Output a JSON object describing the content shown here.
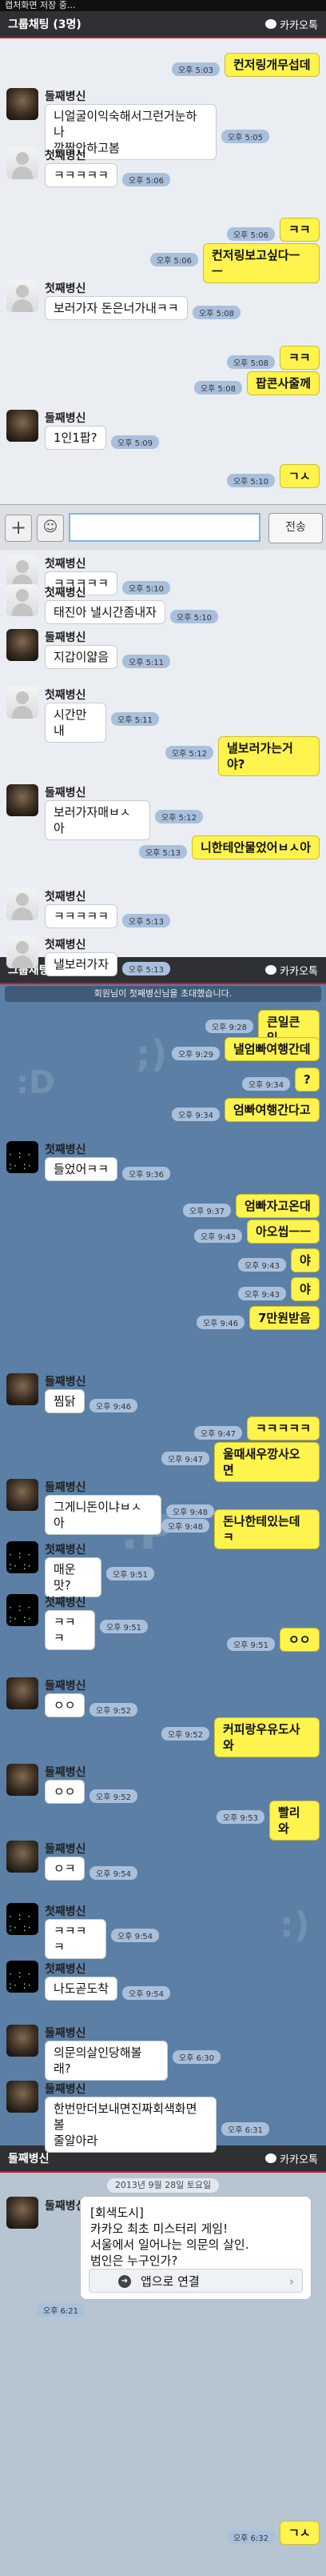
{
  "status_bar": {
    "text": "캡처화면 저장 중..."
  },
  "titlebars": [
    {
      "title": "그룹채팅 (3명)",
      "brand": "카카오톡"
    },
    {
      "title": "그룹채팅 (3명)",
      "brand": "카카오톡"
    },
    {
      "title": "둘째병신",
      "brand": "카카오톡"
    }
  ],
  "input": {
    "plus": "+",
    "emoji": "☺",
    "placeholder": "",
    "send": "전송"
  },
  "notice": "회원님이 첫째병신님을 초대했습니다.",
  "date_separator": "2013년 9월 28일 토요일",
  "card": {
    "text": "[회색도시]\n카카오 최초 미스터리 게임!\n서울에서 일어나는 의문의 살인.\n범인은 누구인가?",
    "button": "앱으로 연결"
  },
  "messages": [
    {
      "side": "me",
      "text": "컨저링개무섭데",
      "time": "오후 5:03"
    },
    {
      "side": "other",
      "sender": "둘째병신",
      "avatar": "dark",
      "text": "니얼굴이익숙해서그런거눈하나\n깜짝안하고봄",
      "time": "오후 5:05"
    },
    {
      "side": "other",
      "sender": "첫째병신",
      "avatar": "ghost",
      "text": "ㅋㅋㅋㅋㅋ",
      "time": "오후 5:06"
    },
    {
      "side": "me",
      "text": "ㅋㅋ",
      "time": "오후 5:06"
    },
    {
      "side": "me",
      "text": "컨저링보고싶다ㅡㅡ",
      "time": "오후 5:06"
    },
    {
      "side": "other",
      "sender": "첫째병신",
      "avatar": "ghost",
      "text": "보러가자 돈은너가내ㅋㅋ",
      "time": "오후 5:08"
    },
    {
      "side": "me",
      "text": "ㅋㅋ",
      "time": "오후 5:08"
    },
    {
      "side": "me",
      "text": "팝콘사줄께",
      "time": "오후 5:08"
    },
    {
      "side": "other",
      "sender": "둘째병신",
      "avatar": "dark",
      "text": "1인1팝?",
      "time": "오후 5:09"
    },
    {
      "side": "me",
      "text": "ㄱㅅ",
      "time": "오후 5:10"
    },
    {
      "side": "other",
      "sender": "첫째병신",
      "avatar": "ghost",
      "text": "ㅋㅋㅋㅋㅋ",
      "time": "오후 5:10"
    },
    {
      "side": "other",
      "sender": "첫째병신",
      "avatar": "ghost",
      "text": "태진아 낼시간좀내자",
      "time": "오후 5:10"
    },
    {
      "side": "other",
      "sender": "둘째병신",
      "avatar": "dark",
      "text": "지갑이얇음",
      "time": "오후 5:11"
    },
    {
      "side": "other",
      "sender": "첫째병신",
      "avatar": "ghost",
      "text": "시간만내",
      "time": "오후 5:11"
    },
    {
      "side": "me",
      "text": "낼보러가는거야?",
      "time": "오후 5:12"
    },
    {
      "side": "other",
      "sender": "둘째병신",
      "avatar": "dark",
      "text": "보러가자매ㅂㅅ아",
      "time": "오후 5:12"
    },
    {
      "side": "me",
      "text": "니한테안물었어ㅂㅅ아",
      "time": "오후 5:13"
    },
    {
      "side": "other",
      "sender": "첫째병신",
      "avatar": "ghost",
      "text": "ㅋㅋㅋㅋㅋ",
      "time": "오후 5:13"
    },
    {
      "side": "other",
      "sender": "첫째병신",
      "avatar": "ghost",
      "text": "낼보러가자",
      "time": "오후 5:13"
    },
    {
      "side": "me",
      "text": "큰일큰일",
      "time": "오후 9:28"
    },
    {
      "side": "me",
      "text": "낼엄빠여행간데",
      "time": "오후 9:29"
    },
    {
      "side": "me",
      "text": "?",
      "time": "오후 9:34"
    },
    {
      "side": "me",
      "text": "엄빠여행간다고",
      "time": "오후 9:34"
    },
    {
      "side": "other",
      "sender": "첫째병신",
      "avatar": "dots",
      "text": "들었어ㅋㅋ",
      "time": "오후 9:36"
    },
    {
      "side": "me",
      "text": "엄빠자고온대",
      "time": "오후 9:37"
    },
    {
      "side": "me",
      "text": "아오씹ㅡㅡ",
      "time": "오후 9:43"
    },
    {
      "side": "me",
      "text": "야",
      "time": "오후 9:43"
    },
    {
      "side": "me",
      "text": "야",
      "time": "오후 9:43"
    },
    {
      "side": "me",
      "text": "7만원받음",
      "time": "오후 9:46"
    },
    {
      "side": "other",
      "sender": "둘째병신",
      "avatar": "dark",
      "text": "찜닭",
      "time": "오후 9:46"
    },
    {
      "side": "me",
      "text": "ㅋㅋㅋㅋㅋ",
      "time": "오후 9:47"
    },
    {
      "side": "me",
      "text": "울때새우깡사오면",
      "time": "오후 9:47"
    },
    {
      "side": "other",
      "sender": "둘째병신",
      "avatar": "dark",
      "text": "그게니돈이냐ㅂㅅ아",
      "time": "오후 9:48"
    },
    {
      "side": "me",
      "text": "돈나한테있는데ㅋ",
      "time": "오후 9:48"
    },
    {
      "side": "other",
      "sender": "첫째병신",
      "avatar": "dots",
      "text": "매운맛?",
      "time": "오후 9:51"
    },
    {
      "side": "other",
      "sender": "첫째병신",
      "avatar": "dots",
      "text": "ㅋㅋㅋ",
      "time": "오후 9:51"
    },
    {
      "side": "me",
      "text": "ㅇㅇ",
      "time": "오후 9:51"
    },
    {
      "side": "other",
      "sender": "둘째병신",
      "avatar": "dark",
      "text": "ㅇㅇ",
      "time": "오후 9:52"
    },
    {
      "side": "me",
      "text": "커피랑우유도사와",
      "time": "오후 9:52"
    },
    {
      "side": "other",
      "sender": "둘째병신",
      "avatar": "dark",
      "text": "ㅇㅇ",
      "time": "오후 9:52"
    },
    {
      "side": "me",
      "text": "빨리와",
      "time": "오후 9:53"
    },
    {
      "side": "other",
      "sender": "둘째병신",
      "avatar": "dark",
      "text": "ㅇㅋ",
      "time": "오후 9:54"
    },
    {
      "side": "other",
      "sender": "첫째병신",
      "avatar": "dots",
      "text": "ㅋㅋㅋㅋ",
      "time": "오후 9:54"
    },
    {
      "side": "other",
      "sender": "첫째병신",
      "avatar": "dots",
      "text": "나도곧도착",
      "time": "오후 9:54"
    },
    {
      "side": "other",
      "sender": "둘째병신",
      "avatar": "dark",
      "text": "의문의살인당해볼래?",
      "time": "오후 6:30"
    },
    {
      "side": "other",
      "sender": "둘째병신",
      "avatar": "dark",
      "text": "한번만더보내면진짜회색화면볼\n줄알아라",
      "time": "오후 6:31"
    },
    {
      "side": "me",
      "text": "ㄱㅅ",
      "time": "오후 6:32"
    }
  ],
  "card_time": "오후 6:21",
  "card_sender": "둘째병신"
}
